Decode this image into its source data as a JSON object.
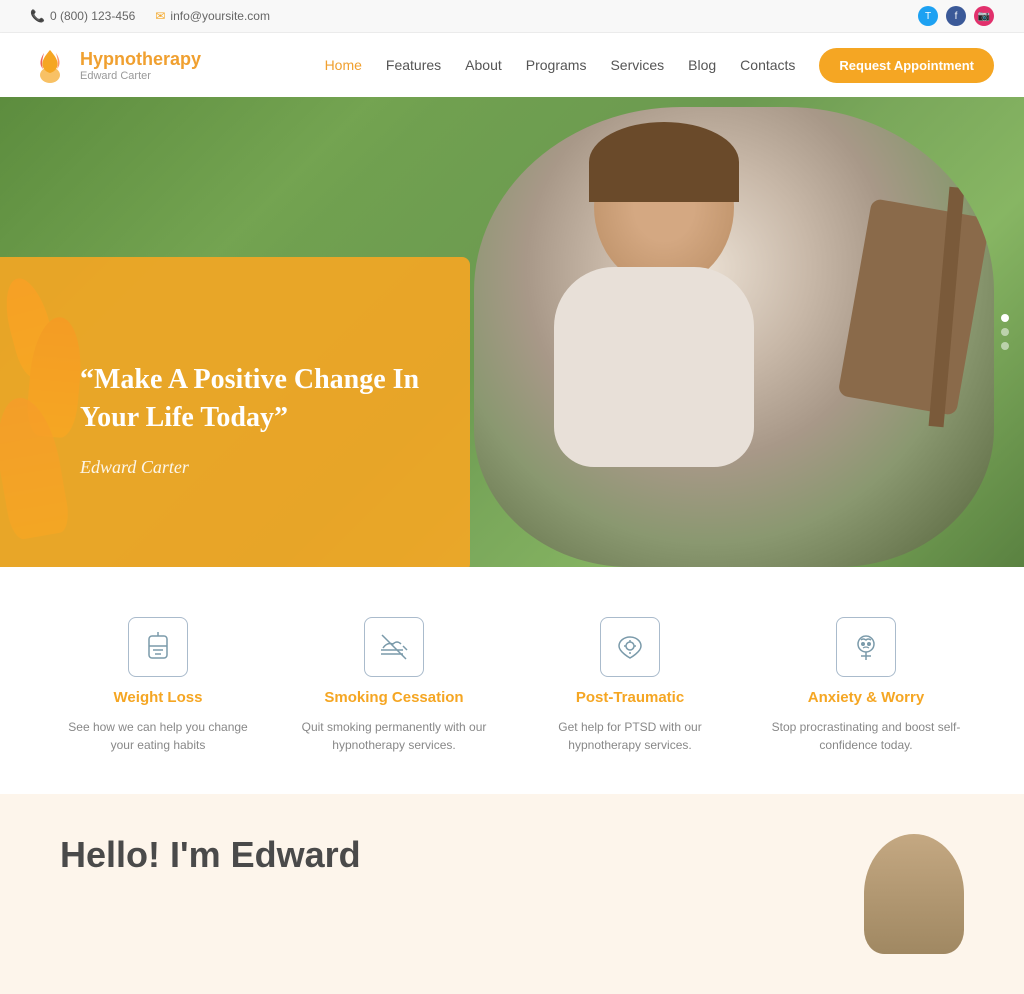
{
  "topbar": {
    "phone_icon": "📞",
    "phone": "0 (800) 123-456",
    "email_icon": "✉",
    "email": "info@yoursite.com",
    "social": [
      "T",
      "f",
      "📷"
    ]
  },
  "header": {
    "logo_title": "Hypnotherapy",
    "logo_subtitle": "Edward Carter",
    "nav_items": [
      {
        "label": "Home",
        "active": true
      },
      {
        "label": "Features",
        "active": false
      },
      {
        "label": "About",
        "active": false
      },
      {
        "label": "Programs",
        "active": false
      },
      {
        "label": "Services",
        "active": false
      },
      {
        "label": "Blog",
        "active": false
      },
      {
        "label": "Contacts",
        "active": false
      }
    ],
    "cta_button": "Request Appointment"
  },
  "hero": {
    "quote": "“Make A Positive Change In Your Life Today”",
    "author": "Edward Carter",
    "dots": [
      true,
      false,
      false
    ]
  },
  "services": [
    {
      "id": "weight-loss",
      "title": "Weight Loss",
      "desc": "See how we can help you change your eating habits"
    },
    {
      "id": "smoking",
      "title": "Smoking Cessation",
      "desc": "Quit smoking permanently with our hypnotherapy services."
    },
    {
      "id": "ptsd",
      "title": "Post-Traumatic",
      "desc": "Get help for PTSD with our hypnotherapy services."
    },
    {
      "id": "anxiety",
      "title": "Anxiety & Worry",
      "desc": "Stop procrastinating and boost self-confidence today."
    }
  ],
  "hello": {
    "title": "Hello! I'm Edward"
  }
}
